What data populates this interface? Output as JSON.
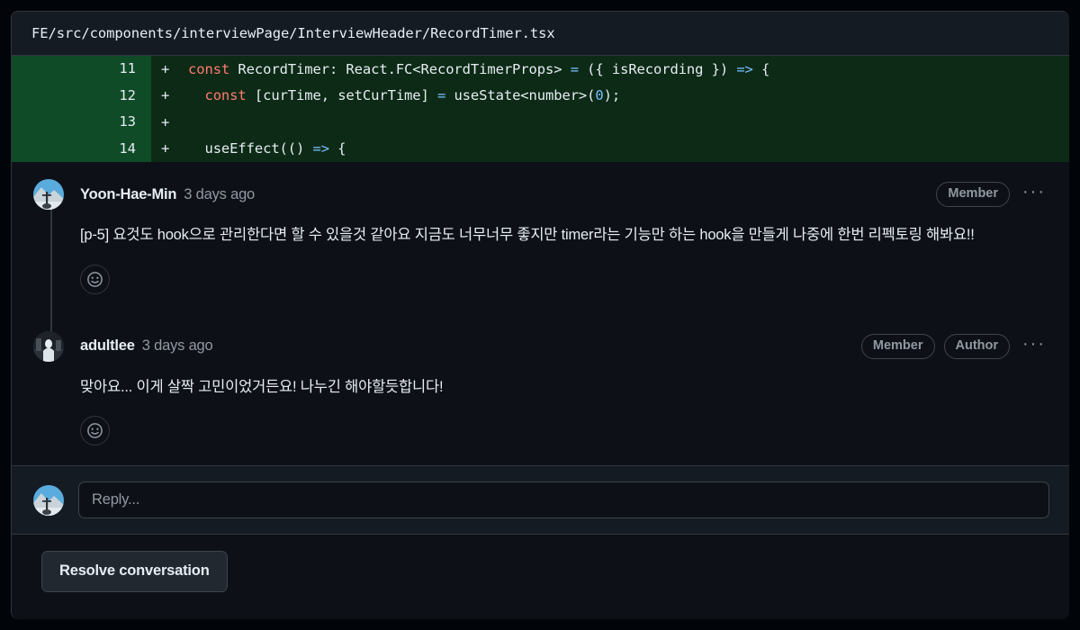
{
  "diff": {
    "file_path": "FE/src/components/interviewPage/InterviewHeader/RecordTimer.tsx",
    "lines": [
      {
        "number": "11",
        "marker": "+",
        "tokens": [
          {
            "t": "",
            "c": "pln"
          },
          {
            "t": "const",
            "c": "key"
          },
          {
            "t": " RecordTimer: React.FC<RecordTimerProps> ",
            "c": "pln"
          },
          {
            "t": "=",
            "c": "op"
          },
          {
            "t": " ({ isRecording }) ",
            "c": "pln"
          },
          {
            "t": "=>",
            "c": "op"
          },
          {
            "t": " {",
            "c": "pln"
          }
        ]
      },
      {
        "number": "12",
        "marker": "+",
        "tokens": [
          {
            "t": "  ",
            "c": "pln"
          },
          {
            "t": "const",
            "c": "key"
          },
          {
            "t": " [curTime, setCurTime] ",
            "c": "pln"
          },
          {
            "t": "=",
            "c": "op"
          },
          {
            "t": " useState<number>(",
            "c": "pln"
          },
          {
            "t": "0",
            "c": "num"
          },
          {
            "t": ");",
            "c": "pln"
          }
        ]
      },
      {
        "number": "13",
        "marker": "+",
        "tokens": [
          {
            "t": "",
            "c": "pln"
          }
        ]
      },
      {
        "number": "14",
        "marker": "+",
        "tokens": [
          {
            "t": "  useEffect(() ",
            "c": "pln"
          },
          {
            "t": "=>",
            "c": "op"
          },
          {
            "t": " {",
            "c": "pln"
          }
        ]
      }
    ]
  },
  "comments": [
    {
      "author": "Yoon-Hae-Min",
      "timestamp": "3 days ago",
      "badges": [
        "Member"
      ],
      "kebab": "···",
      "body": "[p-5] 요것도 hook으로 관리한다면 할 수 있을것 같아요 지금도 너무너무 좋지만 timer라는 기능만 하는 hook을 만들게 나중에 한번 리펙토링 해봐요!!",
      "reaction_icon": "smiley-icon",
      "avatar_type": "mountain"
    },
    {
      "author": "adultlee",
      "timestamp": "3 days ago",
      "badges": [
        "Member",
        "Author"
      ],
      "kebab": "···",
      "body": "맞아요... 이게 살짝 고민이었거든요! 나누긴 해야할듯합니다!",
      "reaction_icon": "smiley-icon",
      "avatar_type": "dark-figure"
    }
  ],
  "reply": {
    "placeholder": "Reply...",
    "avatar_type": "mountain"
  },
  "footer": {
    "resolve_label": "Resolve conversation"
  },
  "colors": {
    "background": "#010409",
    "surface": "#0d1117",
    "surface_alt": "#151b23",
    "border": "#30363d",
    "text": "#e6edf3",
    "muted": "#9198a1",
    "diff_add_bg": "#0d2a16",
    "diff_add_gutter": "#0f4b27",
    "keyword": "#ff7b72",
    "operator": "#79c0ff"
  }
}
